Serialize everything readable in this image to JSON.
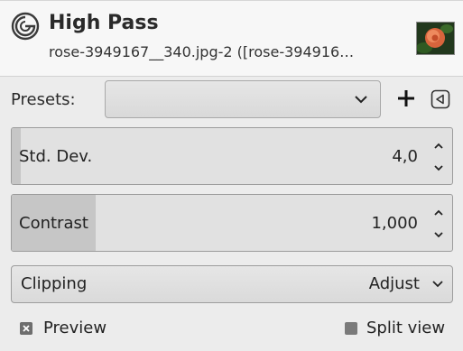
{
  "header": {
    "title": "High Pass",
    "subtitle": "rose-3949167__340.jpg-2 ([rose-394916…",
    "logo_icon": "gimp-wilber-icon",
    "thumbnail_icon": "image-thumbnail-rose"
  },
  "presets": {
    "label": "Presets:",
    "selected": "",
    "add_icon": "plus-icon",
    "menu_icon": "triangle-left-icon"
  },
  "params": {
    "std_dev": {
      "label": "Std. Dev.",
      "value": "4,0",
      "fill_fraction": 0.02
    },
    "contrast": {
      "label": "Contrast",
      "value": "1,000",
      "fill_fraction": 0.19
    }
  },
  "clipping": {
    "label": "Clipping",
    "value": "Adjust"
  },
  "footer": {
    "preview_label": "Preview",
    "preview_checked": true,
    "split_label": "Split view",
    "split_checked": false
  },
  "colors": {
    "panel_bg": "#ececec",
    "header_bg": "#f7f7f7",
    "scale_fill": "#c6c6c6",
    "text": "#222222"
  }
}
